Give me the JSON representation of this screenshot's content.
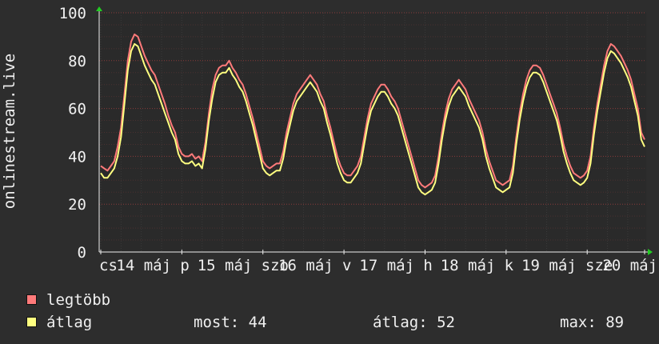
{
  "chart_data": {
    "type": "line",
    "ylabel": "onlinestream.live",
    "ylim": [
      0,
      100
    ],
    "yticks": [
      0,
      20,
      40,
      60,
      80,
      100
    ],
    "grid": true,
    "x_tick_labels": [
      "cs",
      "14 máj",
      "p",
      "15 máj",
      "szo",
      "16 máj",
      "v",
      "17 máj",
      "h",
      "18 máj",
      "k",
      "19 máj",
      "sze",
      "20 máj"
    ],
    "points_per_day": 24,
    "series": [
      {
        "name": "legtöbb",
        "color": "#ff7a7a",
        "values": [
          36,
          35,
          34,
          36,
          38,
          44,
          52,
          66,
          80,
          88,
          91,
          90,
          86,
          82,
          79,
          76,
          74,
          70,
          66,
          62,
          57,
          53,
          50,
          44,
          41,
          40,
          40,
          41,
          39,
          40,
          38,
          46,
          58,
          68,
          74,
          77,
          78,
          78,
          80,
          77,
          75,
          72,
          70,
          66,
          61,
          56,
          50,
          44,
          38,
          36,
          35,
          36,
          37,
          37,
          42,
          50,
          56,
          62,
          66,
          68,
          70,
          72,
          74,
          72,
          70,
          66,
          63,
          57,
          52,
          46,
          40,
          36,
          33,
          32,
          32,
          34,
          36,
          40,
          48,
          56,
          62,
          65,
          68,
          70,
          70,
          68,
          65,
          63,
          60,
          55,
          50,
          45,
          40,
          35,
          30,
          28,
          27,
          28,
          29,
          32,
          40,
          50,
          58,
          64,
          68,
          70,
          72,
          70,
          68,
          64,
          61,
          58,
          55,
          50,
          43,
          38,
          34,
          30,
          29,
          28,
          29,
          30,
          36,
          48,
          58,
          66,
          72,
          76,
          78,
          78,
          77,
          74,
          70,
          66,
          62,
          58,
          52,
          45,
          40,
          36,
          33,
          32,
          31,
          32,
          34,
          40,
          52,
          62,
          70,
          78,
          84,
          87,
          86,
          84,
          82,
          79,
          76,
          72,
          66,
          60,
          50,
          47
        ]
      },
      {
        "name": "átlag",
        "color": "#ffff80",
        "values": [
          33,
          31,
          31,
          33,
          35,
          40,
          48,
          62,
          76,
          84,
          87,
          86,
          82,
          78,
          75,
          72,
          70,
          66,
          62,
          58,
          54,
          50,
          47,
          41,
          38,
          37,
          37,
          38,
          36,
          37,
          35,
          43,
          55,
          64,
          71,
          74,
          75,
          75,
          77,
          74,
          72,
          69,
          67,
          63,
          58,
          53,
          47,
          41,
          35,
          33,
          32,
          33,
          34,
          34,
          39,
          47,
          53,
          59,
          63,
          65,
          67,
          69,
          71,
          69,
          67,
          63,
          60,
          54,
          49,
          43,
          37,
          33,
          30,
          29,
          29,
          31,
          33,
          37,
          45,
          53,
          59,
          62,
          65,
          67,
          67,
          65,
          62,
          60,
          57,
          52,
          47,
          42,
          37,
          32,
          27,
          25,
          24,
          25,
          26,
          29,
          37,
          47,
          55,
          61,
          65,
          67,
          69,
          67,
          65,
          61,
          58,
          55,
          52,
          47,
          40,
          35,
          31,
          27,
          26,
          25,
          26,
          27,
          33,
          45,
          55,
          63,
          69,
          73,
          75,
          75,
          74,
          71,
          67,
          63,
          59,
          55,
          49,
          42,
          37,
          33,
          30,
          29,
          28,
          29,
          31,
          37,
          49,
          59,
          67,
          75,
          81,
          84,
          83,
          81,
          79,
          76,
          73,
          69,
          63,
          57,
          47,
          44
        ]
      }
    ]
  },
  "legend": [
    {
      "label": "legtöbb",
      "color": "#ff7a7a"
    },
    {
      "label": "átlag",
      "color": "#ffff80"
    }
  ],
  "stats": {
    "most": "most: 44",
    "atlag": "átlag: 52",
    "max": "max: 89"
  }
}
